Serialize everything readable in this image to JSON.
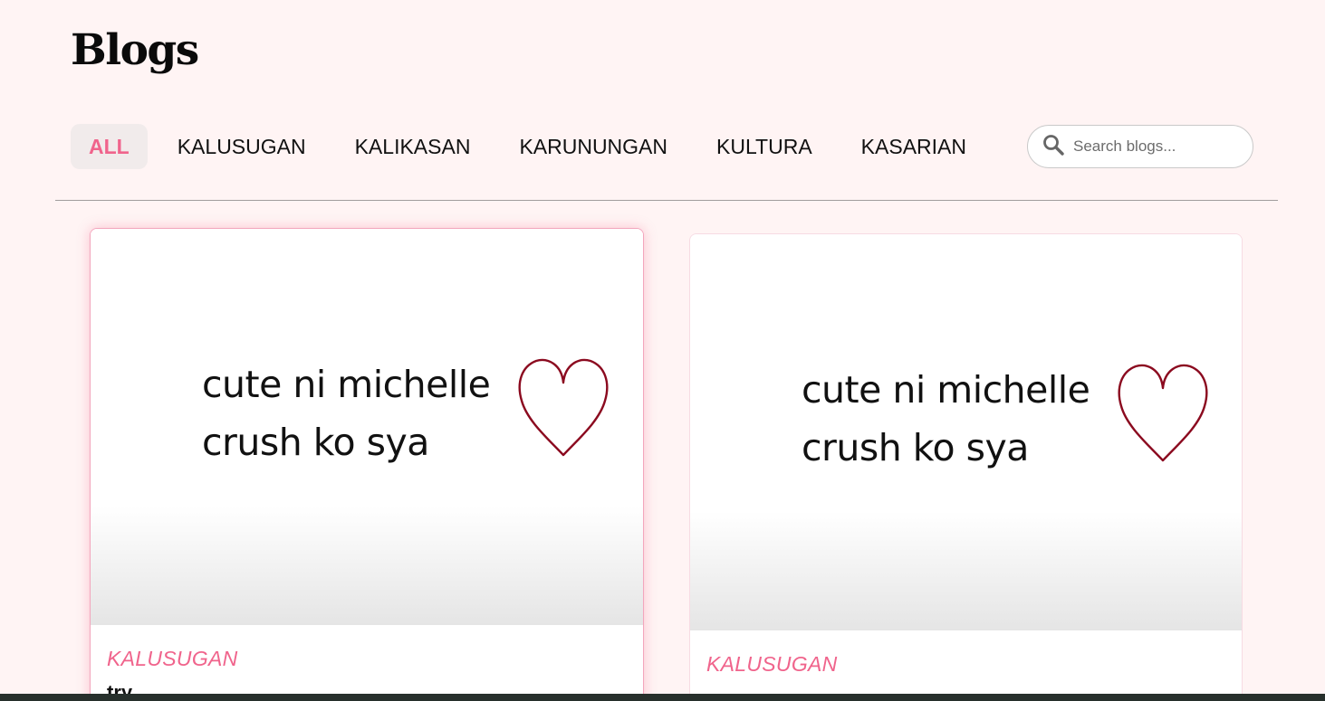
{
  "header": {
    "title": "Blogs"
  },
  "tabs": [
    {
      "label": "ALL",
      "active": true
    },
    {
      "label": "KALUSUGAN",
      "active": false
    },
    {
      "label": "KALIKASAN",
      "active": false
    },
    {
      "label": "KARUNUNGAN",
      "active": false
    },
    {
      "label": "KULTURA",
      "active": false
    },
    {
      "label": "KASARIAN",
      "active": false
    }
  ],
  "search": {
    "placeholder": "Search blogs...",
    "value": "",
    "icon": "search-icon"
  },
  "posts": [
    {
      "image_text_line1": "cute ni michelle",
      "image_text_line2": "crush ko sya",
      "image_icon": "heart-icon",
      "category": "KALUSUGAN",
      "title": "try"
    },
    {
      "image_text_line1": "cute ni michelle",
      "image_text_line2": "crush ko sya",
      "image_icon": "heart-icon",
      "category": "KALUSUGAN",
      "title": ""
    }
  ],
  "colors": {
    "background": "#fff4f4",
    "accent": "#f0648c",
    "active_tab_bg": "#f1ebeb",
    "heart": "#8b0a1f",
    "taskbar": "#27302c"
  }
}
